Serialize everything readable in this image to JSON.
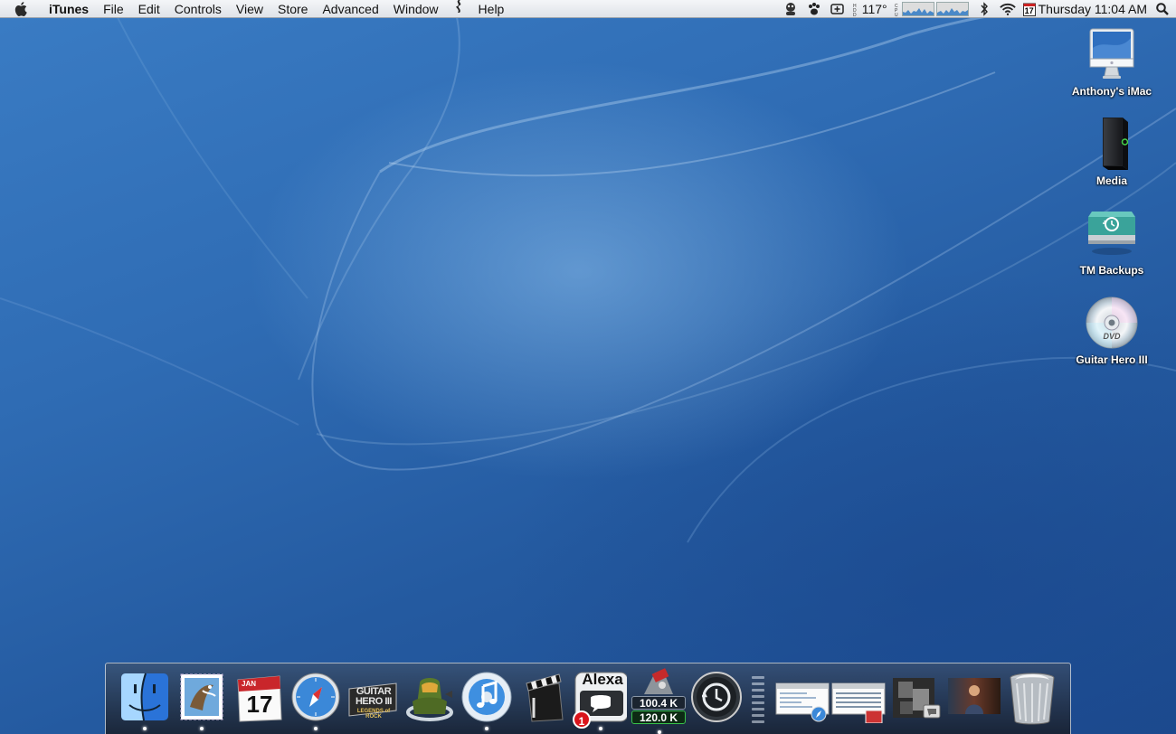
{
  "menubar": {
    "app_name": "iTunes",
    "menus": [
      "File",
      "Edit",
      "Controls",
      "View",
      "Store",
      "Advanced",
      "Window",
      "Help"
    ],
    "status": {
      "temperature": "117°",
      "clock": "Thursday 11:04 AM",
      "calendar_day": "17"
    }
  },
  "desktop": {
    "icons": [
      {
        "label": "Anthony's iMac",
        "icon": "imac-icon"
      },
      {
        "label": "Media",
        "icon": "external-drive-icon"
      },
      {
        "label": "TM Backups",
        "icon": "time-machine-drive-icon"
      },
      {
        "label": "Guitar Hero III",
        "icon": "dvd-icon"
      }
    ]
  },
  "dock": {
    "ical_month": "JAN",
    "ical_day": "17",
    "alexa_label": "Alexa",
    "alexa_badge": "1",
    "net_up": "100.4 K",
    "net_down": "120.0 K",
    "guitar_hero_title": "GUITAR HERO III",
    "guitar_hero_sub": "LEGENDS of ROCK",
    "items": [
      "finder-icon",
      "mail-icon",
      "ical-icon",
      "safari-icon",
      "guitar-hero-icon",
      "halo-icon",
      "itunes-icon",
      "movie-clapper-icon",
      "alexa-icon",
      "network-monitor-icon",
      "time-machine-icon",
      "minimized-window-1",
      "minimized-window-2",
      "minimized-window-3",
      "minimized-window-4",
      "trash-icon"
    ]
  }
}
